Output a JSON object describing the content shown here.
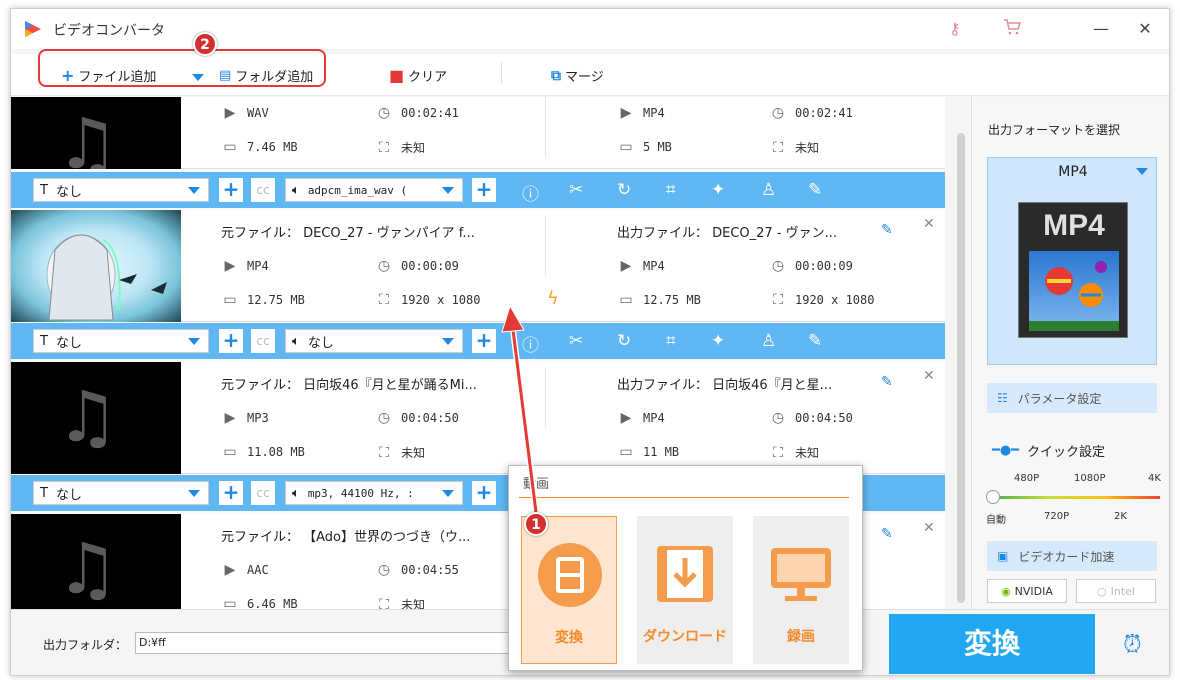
{
  "window": {
    "title": "ビデオコンバータ",
    "min": "—",
    "max": "☐",
    "close": "✕",
    "key_icon": "key-icon",
    "cart_icon": "cart-icon"
  },
  "toolbar": {
    "add_file": "ファイル追加",
    "add_folder": "フォルダ追加",
    "clear": "クリア",
    "merge": "マージ"
  },
  "badges": {
    "one": "1",
    "two": "2"
  },
  "items": [
    {
      "src_title": "",
      "out_title": "",
      "src_format": "WAV",
      "src_duration": "00:02:41",
      "src_size": "7.46 MB",
      "src_res": "未知",
      "out_format": "MP4",
      "out_duration": "00:02:41",
      "out_size": "5 MB",
      "out_res": "未知",
      "subtitle": "なし",
      "audio": "adpcm_ima_wav ("
    },
    {
      "src_title": "元ファイル： DECO_27 - ヴァンパイア f...",
      "out_title": "出力ファイル： DECO_27 - ヴァン...",
      "src_format": "MP4",
      "src_duration": "00:00:09",
      "src_size": "12.75 MB",
      "src_res": "1920 x 1080",
      "out_format": "MP4",
      "out_duration": "00:00:09",
      "out_size": "12.75 MB",
      "out_res": "1920 x 1080",
      "subtitle": "なし",
      "audio": "なし"
    },
    {
      "src_title": "元ファイル： 日向坂46『月と星が踊るMi...",
      "out_title": "出力ファイル： 日向坂46『月と星...",
      "src_format": "MP3",
      "src_duration": "00:04:50",
      "src_size": "11.08 MB",
      "src_res": "未知",
      "out_format": "MP4",
      "out_duration": "00:04:50",
      "out_size": "11 MB",
      "out_res": "未知",
      "subtitle": "なし",
      "audio": "mp3, 44100 Hz, :"
    },
    {
      "src_title": "元ファイル： 【Ado】世界のつづき（ウ...",
      "out_title": "",
      "src_format": "AAC",
      "src_duration": "00:04:55",
      "src_size": "6.46 MB",
      "src_res": "未知",
      "out_format": "",
      "out_duration": "",
      "out_size": "",
      "out_res": "",
      "subtitle": "",
      "audio": ""
    }
  ],
  "right_panel": {
    "select_format_label": "出力フォーマットを選択",
    "format": "MP4",
    "format_image_text": "MP4",
    "param_settings": "パラメータ設定",
    "quick_settings": "クイック設定",
    "res_top": [
      "480P",
      "1080P",
      "4K"
    ],
    "res_bottom": [
      "自動",
      "720P",
      "2K"
    ],
    "gpu_accel": "ビデオカード加速",
    "nvidia": "NVIDIA",
    "intel": "Intel"
  },
  "bottom": {
    "output_folder_label": "出力フォルダ：",
    "output_folder_value": "D:¥ff",
    "convert": "変換"
  },
  "popup": {
    "search_text": "動画",
    "cards": [
      "変換",
      "ダウンロード",
      "録画"
    ]
  }
}
